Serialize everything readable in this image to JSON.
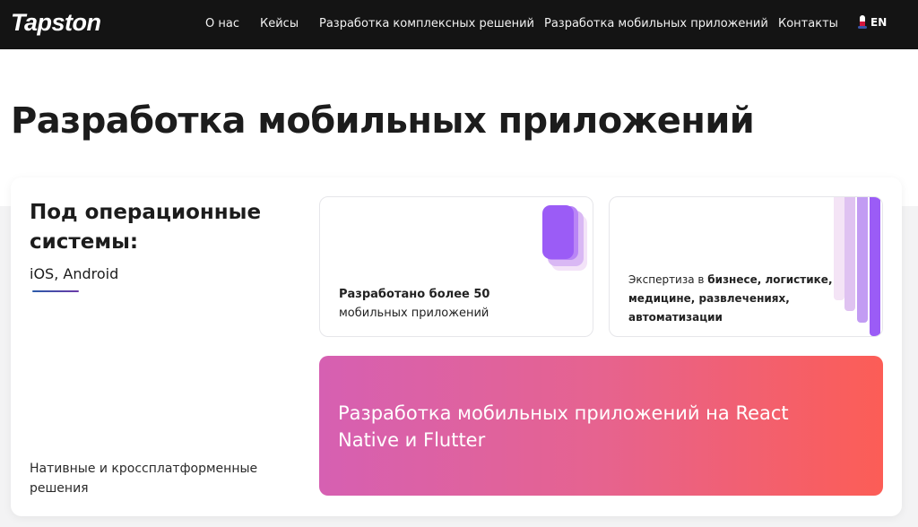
{
  "header": {
    "logo": "Tapston",
    "nav": [
      {
        "label": "О нас"
      },
      {
        "label": "Кейсы"
      },
      {
        "label": "Разработка комплексных решений"
      },
      {
        "label": "Разработка мобильных приложений"
      },
      {
        "label": "Контакты"
      }
    ],
    "language": {
      "code": "EN",
      "icon": "flag-icon"
    }
  },
  "page": {
    "title": "Разработка мобильных приложений"
  },
  "platforms": {
    "heading": "Под операционные системы:",
    "list": "iOS, Android",
    "note": "Нативные и кроссплатформенные решения"
  },
  "cards": {
    "apps": {
      "bold": "Разработано более 50",
      "rest": "мобильных приложений"
    },
    "expertise": {
      "lead": "Экспертиза в ",
      "bold": "бизнесе, логистике, медицине, развлечениях, автоматизации"
    },
    "cta": {
      "text": "Разработка мобильных приложений на React Native и Flutter"
    }
  },
  "colors": {
    "header_bg": "#141414",
    "accent_purple": "#9b5cf6",
    "gradient_start": "#d660b2",
    "gradient_end": "#fc5d56"
  }
}
